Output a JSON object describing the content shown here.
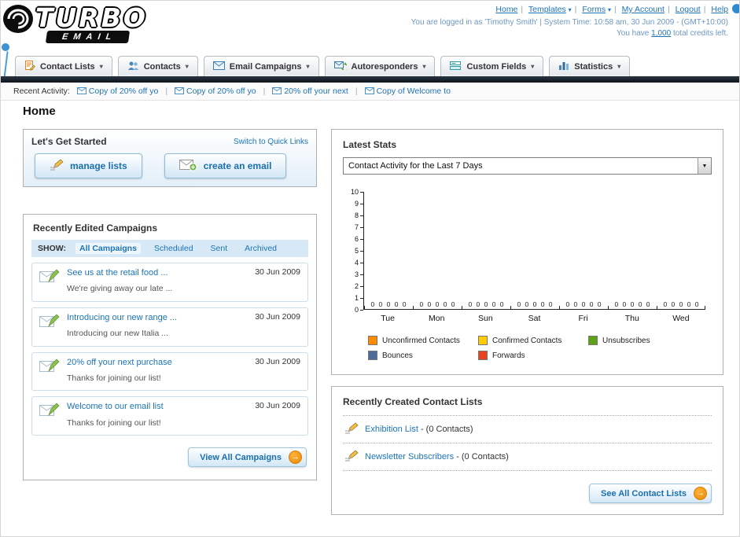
{
  "header": {
    "logo_title": "TURBO",
    "logo_subtitle": "EMAIL",
    "nav": [
      {
        "label": "Home"
      },
      {
        "label": "Templates"
      },
      {
        "label": "Forms"
      },
      {
        "label": "My Account"
      },
      {
        "label": "Logout"
      },
      {
        "label": "Help"
      }
    ],
    "login_info": "You are logged in as 'Timothy Smith' | System Time: 10:58 am, 30 Jun 2009 - (GMT+10:00)",
    "credits_prefix": "You have",
    "credits_value": "1,000",
    "credits_suffix": "total credits left."
  },
  "tabs": [
    {
      "label": "Contact Lists",
      "icon": "contact-lists-icon"
    },
    {
      "label": "Contacts",
      "icon": "contacts-icon"
    },
    {
      "label": "Email Campaigns",
      "icon": "email-campaigns-icon"
    },
    {
      "label": "Autoresponders",
      "icon": "autoresponders-icon"
    },
    {
      "label": "Custom Fields",
      "icon": "custom-fields-icon"
    },
    {
      "label": "Statistics",
      "icon": "statistics-icon"
    }
  ],
  "recent_activity": {
    "label": "Recent Activity:",
    "items": [
      "Copy of 20% off yo",
      "Copy of 20% off yo",
      "20% off your next",
      "Copy of Welcome to"
    ]
  },
  "page_title": "Home",
  "get_started": {
    "title": "Let's Get Started",
    "switch_link": "Switch to Quick Links",
    "manage_lists_button": "manage lists",
    "create_email_button": "create an email"
  },
  "campaigns": {
    "title": "Recently Edited Campaigns",
    "show_label": "SHOW:",
    "filters": [
      {
        "label": "All Campaigns",
        "selected": true
      },
      {
        "label": "Scheduled",
        "selected": false
      },
      {
        "label": "Sent",
        "selected": false
      },
      {
        "label": "Archived",
        "selected": false
      }
    ],
    "items": [
      {
        "title": "See us at the retail food ...",
        "subtitle": "We're giving away our late ...",
        "date": "30 Jun 2009"
      },
      {
        "title": "Introducing our new range ...",
        "subtitle": "Introducing our new Italia ...",
        "date": "30 Jun 2009"
      },
      {
        "title": "20% off your next purchase",
        "subtitle": "Thanks for joining our list!",
        "date": "30 Jun 2009"
      },
      {
        "title": "Welcome to our email list",
        "subtitle": "Thanks for joining our list!",
        "date": "30 Jun 2009"
      }
    ],
    "view_all_label": "View All Campaigns"
  },
  "stats": {
    "title": "Latest Stats",
    "dropdown_value": "Contact Activity for the Last 7 Days"
  },
  "chart_data": {
    "type": "bar",
    "categories": [
      "Tue",
      "Mon",
      "Sun",
      "Sat",
      "Fri",
      "Thu",
      "Wed"
    ],
    "series": [
      {
        "name": "Unconfirmed Contacts",
        "color": "#ff8a00",
        "values": [
          0,
          0,
          0,
          0,
          0,
          0,
          0
        ]
      },
      {
        "name": "Confirmed Contacts",
        "color": "#ffcc00",
        "values": [
          0,
          0,
          0,
          0,
          0,
          0,
          0
        ]
      },
      {
        "name": "Unsubscribes",
        "color": "#5ca315",
        "values": [
          0,
          0,
          0,
          0,
          0,
          0,
          0
        ]
      },
      {
        "name": "Bounces",
        "color": "#4a6d9e",
        "values": [
          0,
          0,
          0,
          0,
          0,
          0,
          0
        ]
      },
      {
        "name": "Forwards",
        "color": "#e8431f",
        "values": [
          0,
          0,
          0,
          0,
          0,
          0,
          0
        ]
      }
    ],
    "ylim": [
      0,
      10
    ],
    "ytick_step": 1,
    "grid": false,
    "legend_position": "bottom"
  },
  "contact_lists": {
    "title": "Recently Created Contact Lists",
    "items": [
      {
        "name": "Exhibition List",
        "suffix": "- (0 Contacts)"
      },
      {
        "name": "Newsletter Subscribers",
        "suffix": "- (0 Contacts)"
      }
    ],
    "see_all_label": "See All Contact Lists"
  }
}
